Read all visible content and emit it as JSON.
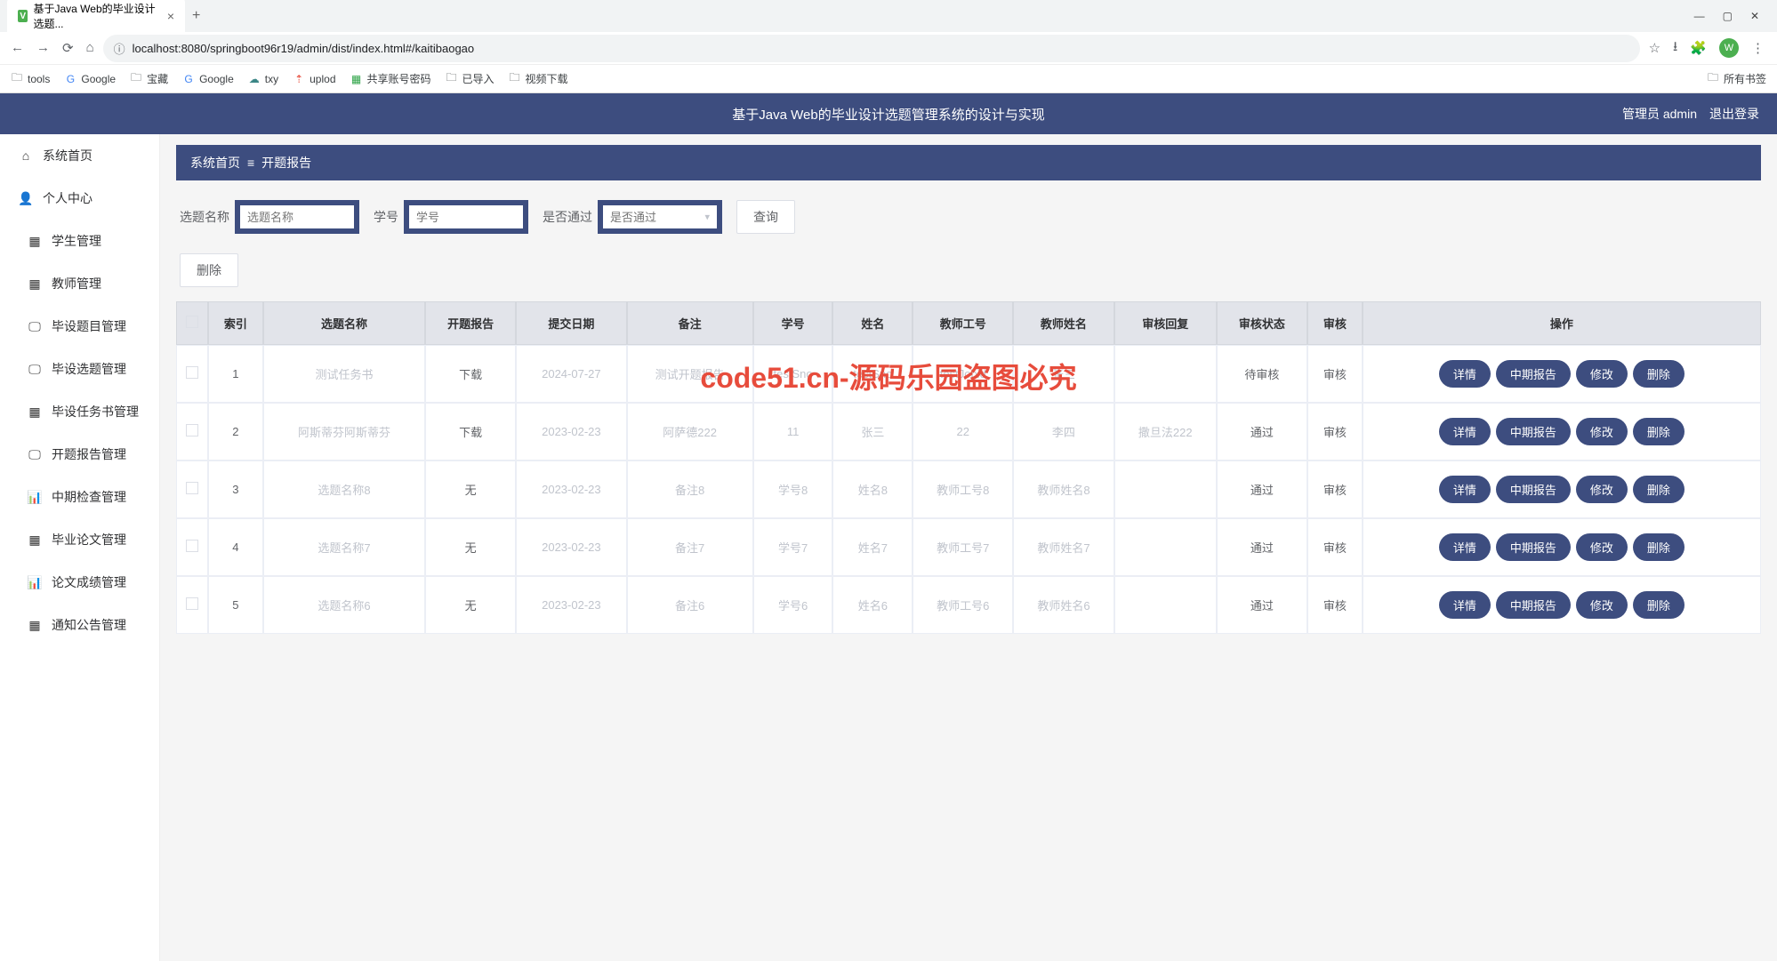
{
  "browser": {
    "tab_title": "基于Java Web的毕业设计选题...",
    "url": "localhost:8080/springboot96r19/admin/dist/index.html#/kaitibaogao",
    "bookmarks": [
      "tools",
      "Google",
      "宝藏",
      "Google",
      "txy",
      "uplod",
      "共享账号密码",
      "已导入",
      "视频下载"
    ],
    "all_bookmarks": "所有书签"
  },
  "header": {
    "title": "基于Java Web的毕业设计选题管理系统的设计与实现",
    "user_label": "管理员 admin",
    "logout": "退出登录"
  },
  "sidebar": {
    "items": [
      {
        "icon": "⌂",
        "label": "系统首页"
      },
      {
        "icon": "👤",
        "label": "个人中心"
      },
      {
        "icon": "▦",
        "label": "学生管理"
      },
      {
        "icon": "▦",
        "label": "教师管理"
      },
      {
        "icon": "🖵",
        "label": "毕设题目管理"
      },
      {
        "icon": "🖵",
        "label": "毕设选题管理"
      },
      {
        "icon": "▦",
        "label": "毕设任务书管理"
      },
      {
        "icon": "🖵",
        "label": "开题报告管理"
      },
      {
        "icon": "📊",
        "label": "中期检查管理"
      },
      {
        "icon": "▦",
        "label": "毕业论文管理"
      },
      {
        "icon": "📊",
        "label": "论文成绩管理"
      },
      {
        "icon": "▦",
        "label": "通知公告管理"
      }
    ]
  },
  "crumb": {
    "home": "系统首页",
    "sep": "≡",
    "current": "开题报告"
  },
  "filters": {
    "f1_label": "选题名称",
    "f1_ph": "选题名称",
    "f2_label": "学号",
    "f2_ph": "学号",
    "f3_label": "是否通过",
    "f3_ph": "是否通过",
    "search": "查询",
    "delete": "删除"
  },
  "table": {
    "headers": [
      "",
      "索引",
      "选题名称",
      "开题报告",
      "提交日期",
      "备注",
      "学号",
      "姓名",
      "教师工号",
      "教师姓名",
      "审核回复",
      "审核状态",
      "审核",
      "操作"
    ],
    "ops": {
      "detail": "详情",
      "mid": "中期报告",
      "edit": "修改",
      "del": "删除"
    },
    "rows": [
      {
        "idx": "1",
        "name": "测试任务书",
        "report": "下载",
        "date": "2024-07-27",
        "note": "测试开题报告",
        "sid": "testSno",
        "sname": "testSno",
        "tid": "testJobid",
        "tname": "张三",
        "reply": "",
        "status": "待审核",
        "audit": "审核"
      },
      {
        "idx": "2",
        "name": "阿斯蒂芬阿斯蒂芬",
        "report": "下载",
        "date": "2023-02-23",
        "note": "阿萨德222",
        "sid": "11",
        "sname": "张三",
        "tid": "22",
        "tname": "李四",
        "reply": "撒旦法222",
        "status": "通过",
        "audit": "审核"
      },
      {
        "idx": "3",
        "name": "选题名称8",
        "report": "无",
        "date": "2023-02-23",
        "note": "备注8",
        "sid": "学号8",
        "sname": "姓名8",
        "tid": "教师工号8",
        "tname": "教师姓名8",
        "reply": "",
        "status": "通过",
        "audit": "审核"
      },
      {
        "idx": "4",
        "name": "选题名称7",
        "report": "无",
        "date": "2023-02-23",
        "note": "备注7",
        "sid": "学号7",
        "sname": "姓名7",
        "tid": "教师工号7",
        "tname": "教师姓名7",
        "reply": "",
        "status": "通过",
        "audit": "审核"
      },
      {
        "idx": "5",
        "name": "选题名称6",
        "report": "无",
        "date": "2023-02-23",
        "note": "备注6",
        "sid": "学号6",
        "sname": "姓名6",
        "tid": "教师工号6",
        "tname": "教师姓名6",
        "reply": "",
        "status": "通过",
        "audit": "审核"
      }
    ]
  },
  "watermark_big": "code51.cn-源码乐园盗图必究"
}
